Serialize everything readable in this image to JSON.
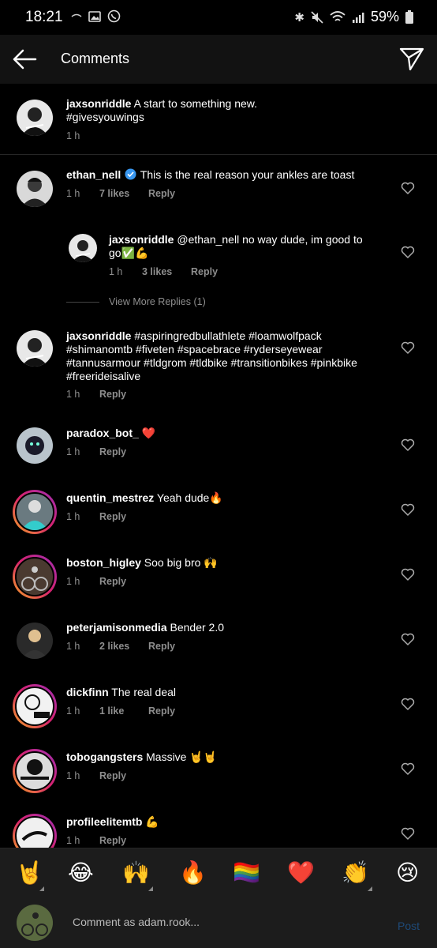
{
  "status": {
    "time": "18:21",
    "battery": "59%"
  },
  "header": {
    "title": "Comments"
  },
  "caption": {
    "username": "jaxsonriddle",
    "text": " A start to something new.",
    "text2": "#givesyouwings",
    "time": "1 h"
  },
  "comments": [
    {
      "username": "ethan_nell",
      "verified": true,
      "text": " This is the real reason your ankles are toast",
      "time": "1 h",
      "likes": "7 likes",
      "reply": "Reply"
    },
    {
      "username": "jaxsonriddle",
      "text": " @ethan_nell no way dude, im good to go✅💪",
      "time": "1 h",
      "likes": "3 likes",
      "reply": "Reply"
    },
    {
      "username": "jaxsonriddle",
      "text": " #aspiringredbullathlete #loamwolfpack #shimanomtb #fiveten #spacebrace #ryderseyewear #tannusarmour #tldgrom #tldbike #transitionbikes #pinkbike #freerideisalive",
      "time": "1 h",
      "reply": "Reply"
    },
    {
      "username": "paradox_bot_",
      "text": " ❤️",
      "time": "1 h",
      "reply": "Reply"
    },
    {
      "username": "quentin_mestrez",
      "text": " Yeah dude🔥",
      "time": "1 h",
      "reply": "Reply"
    },
    {
      "username": "boston_higley",
      "text": " Soo big bro 🙌",
      "time": "1 h",
      "reply": "Reply"
    },
    {
      "username": "peterjamisonmedia",
      "text": " Bender 2.0",
      "time": "1 h",
      "likes": "2 likes",
      "reply": "Reply"
    },
    {
      "username": "dickfinn",
      "text": " The real deal",
      "time": "1 h",
      "likes": "1 like",
      "reply": "Reply"
    },
    {
      "username": "tobogangsters",
      "text": " Massive 🤘🤘",
      "time": "1 h",
      "reply": "Reply"
    },
    {
      "username": "profileelitemtb",
      "text": " 💪",
      "time": "1 h",
      "reply": "Reply"
    }
  ],
  "view_more": "View More Replies (1)",
  "emojis": [
    "🤘",
    "😂",
    "🙌",
    "🔥",
    "🏳️‍🌈",
    "❤️",
    "👏",
    "😢"
  ],
  "composer": {
    "placeholder": "Comment as adam.rook...",
    "post_label": "Post"
  }
}
